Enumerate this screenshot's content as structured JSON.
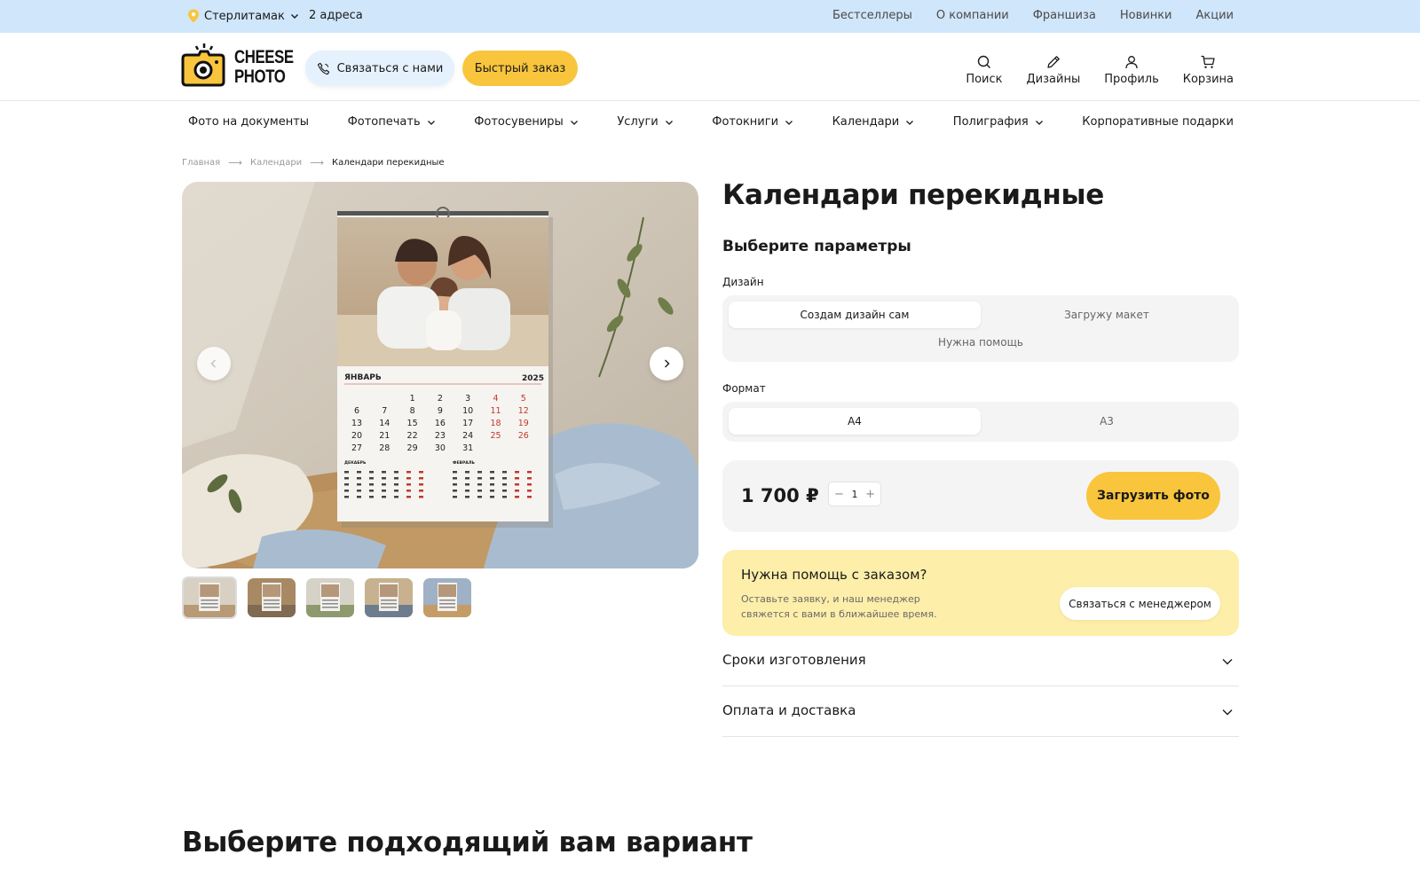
{
  "topbar": {
    "city": "Стерлитамак",
    "addresses": "2 адреса",
    "links": [
      "Бестселлеры",
      "О компании",
      "Франшиза",
      "Новинки",
      "Акции"
    ]
  },
  "header": {
    "logo_line1": "CHEESE",
    "logo_line2": "PHOTO",
    "contact_label": "Связаться с нами",
    "quick_order_label": "Быстрый заказ",
    "icons": {
      "search": "Поиск",
      "designs": "Дизайны",
      "profile": "Профиль",
      "cart": "Корзина"
    }
  },
  "nav": {
    "items": [
      {
        "label": "Фото на документы",
        "dropdown": false
      },
      {
        "label": "Фотопечать",
        "dropdown": true
      },
      {
        "label": "Фотосувениры",
        "dropdown": true
      },
      {
        "label": "Услуги",
        "dropdown": true
      },
      {
        "label": "Фотокниги",
        "dropdown": true
      },
      {
        "label": "Календари",
        "dropdown": true
      },
      {
        "label": "Полиграфия",
        "dropdown": true
      },
      {
        "label": "Корпоративные подарки",
        "dropdown": false
      }
    ]
  },
  "breadcrumb": [
    "Главная",
    "Календари",
    "Календари перекидные"
  ],
  "gallery": {
    "calendar_month": "ЯНВАРЬ",
    "calendar_year": "2025",
    "mini_months": [
      "ДЕКАБРЬ",
      "ФЕВРАЛЬ"
    ],
    "calendar_rows": [
      [
        "",
        "",
        "1",
        "2",
        "3",
        "4",
        "5"
      ],
      [
        "6",
        "7",
        "8",
        "9",
        "10",
        "11",
        "12"
      ],
      [
        "13",
        "14",
        "15",
        "16",
        "17",
        "18",
        "19"
      ],
      [
        "20",
        "21",
        "22",
        "23",
        "24",
        "25",
        "26"
      ],
      [
        "27",
        "28",
        "29",
        "30",
        "31",
        "",
        ""
      ]
    ],
    "thumbnail_count": 5,
    "active_thumbnail": 1
  },
  "product": {
    "title": "Календари перекидные",
    "params_title": "Выберите параметры",
    "design": {
      "label": "Дизайн",
      "options": [
        "Создам дизайн сам",
        "Загружу макет",
        "Нужна помощь"
      ],
      "selected": "Создам дизайн сам"
    },
    "format": {
      "label": "Формат",
      "options": [
        "А4",
        "А3"
      ],
      "selected": "А4"
    },
    "price": "1 700 ₽",
    "quantity": "1",
    "upload_label": "Загрузить фото"
  },
  "help": {
    "title": "Нужна помощь с заказом?",
    "text": "Оставьте заявку, и наш менеджер свяжется с вами в ближайшее время.",
    "button": "Связаться с менеджером"
  },
  "accordion": [
    "Сроки изготовления",
    "Оплата и доставка"
  ],
  "section_title": "Выберите подходящий вам вариант",
  "colors": {
    "topbar_bg": "#cfe6fb",
    "accent_yellow": "#f8c53d",
    "help_bg": "#fdeea9",
    "segment_bg": "#f4f4f4",
    "weekend_red": "#c0392b"
  }
}
